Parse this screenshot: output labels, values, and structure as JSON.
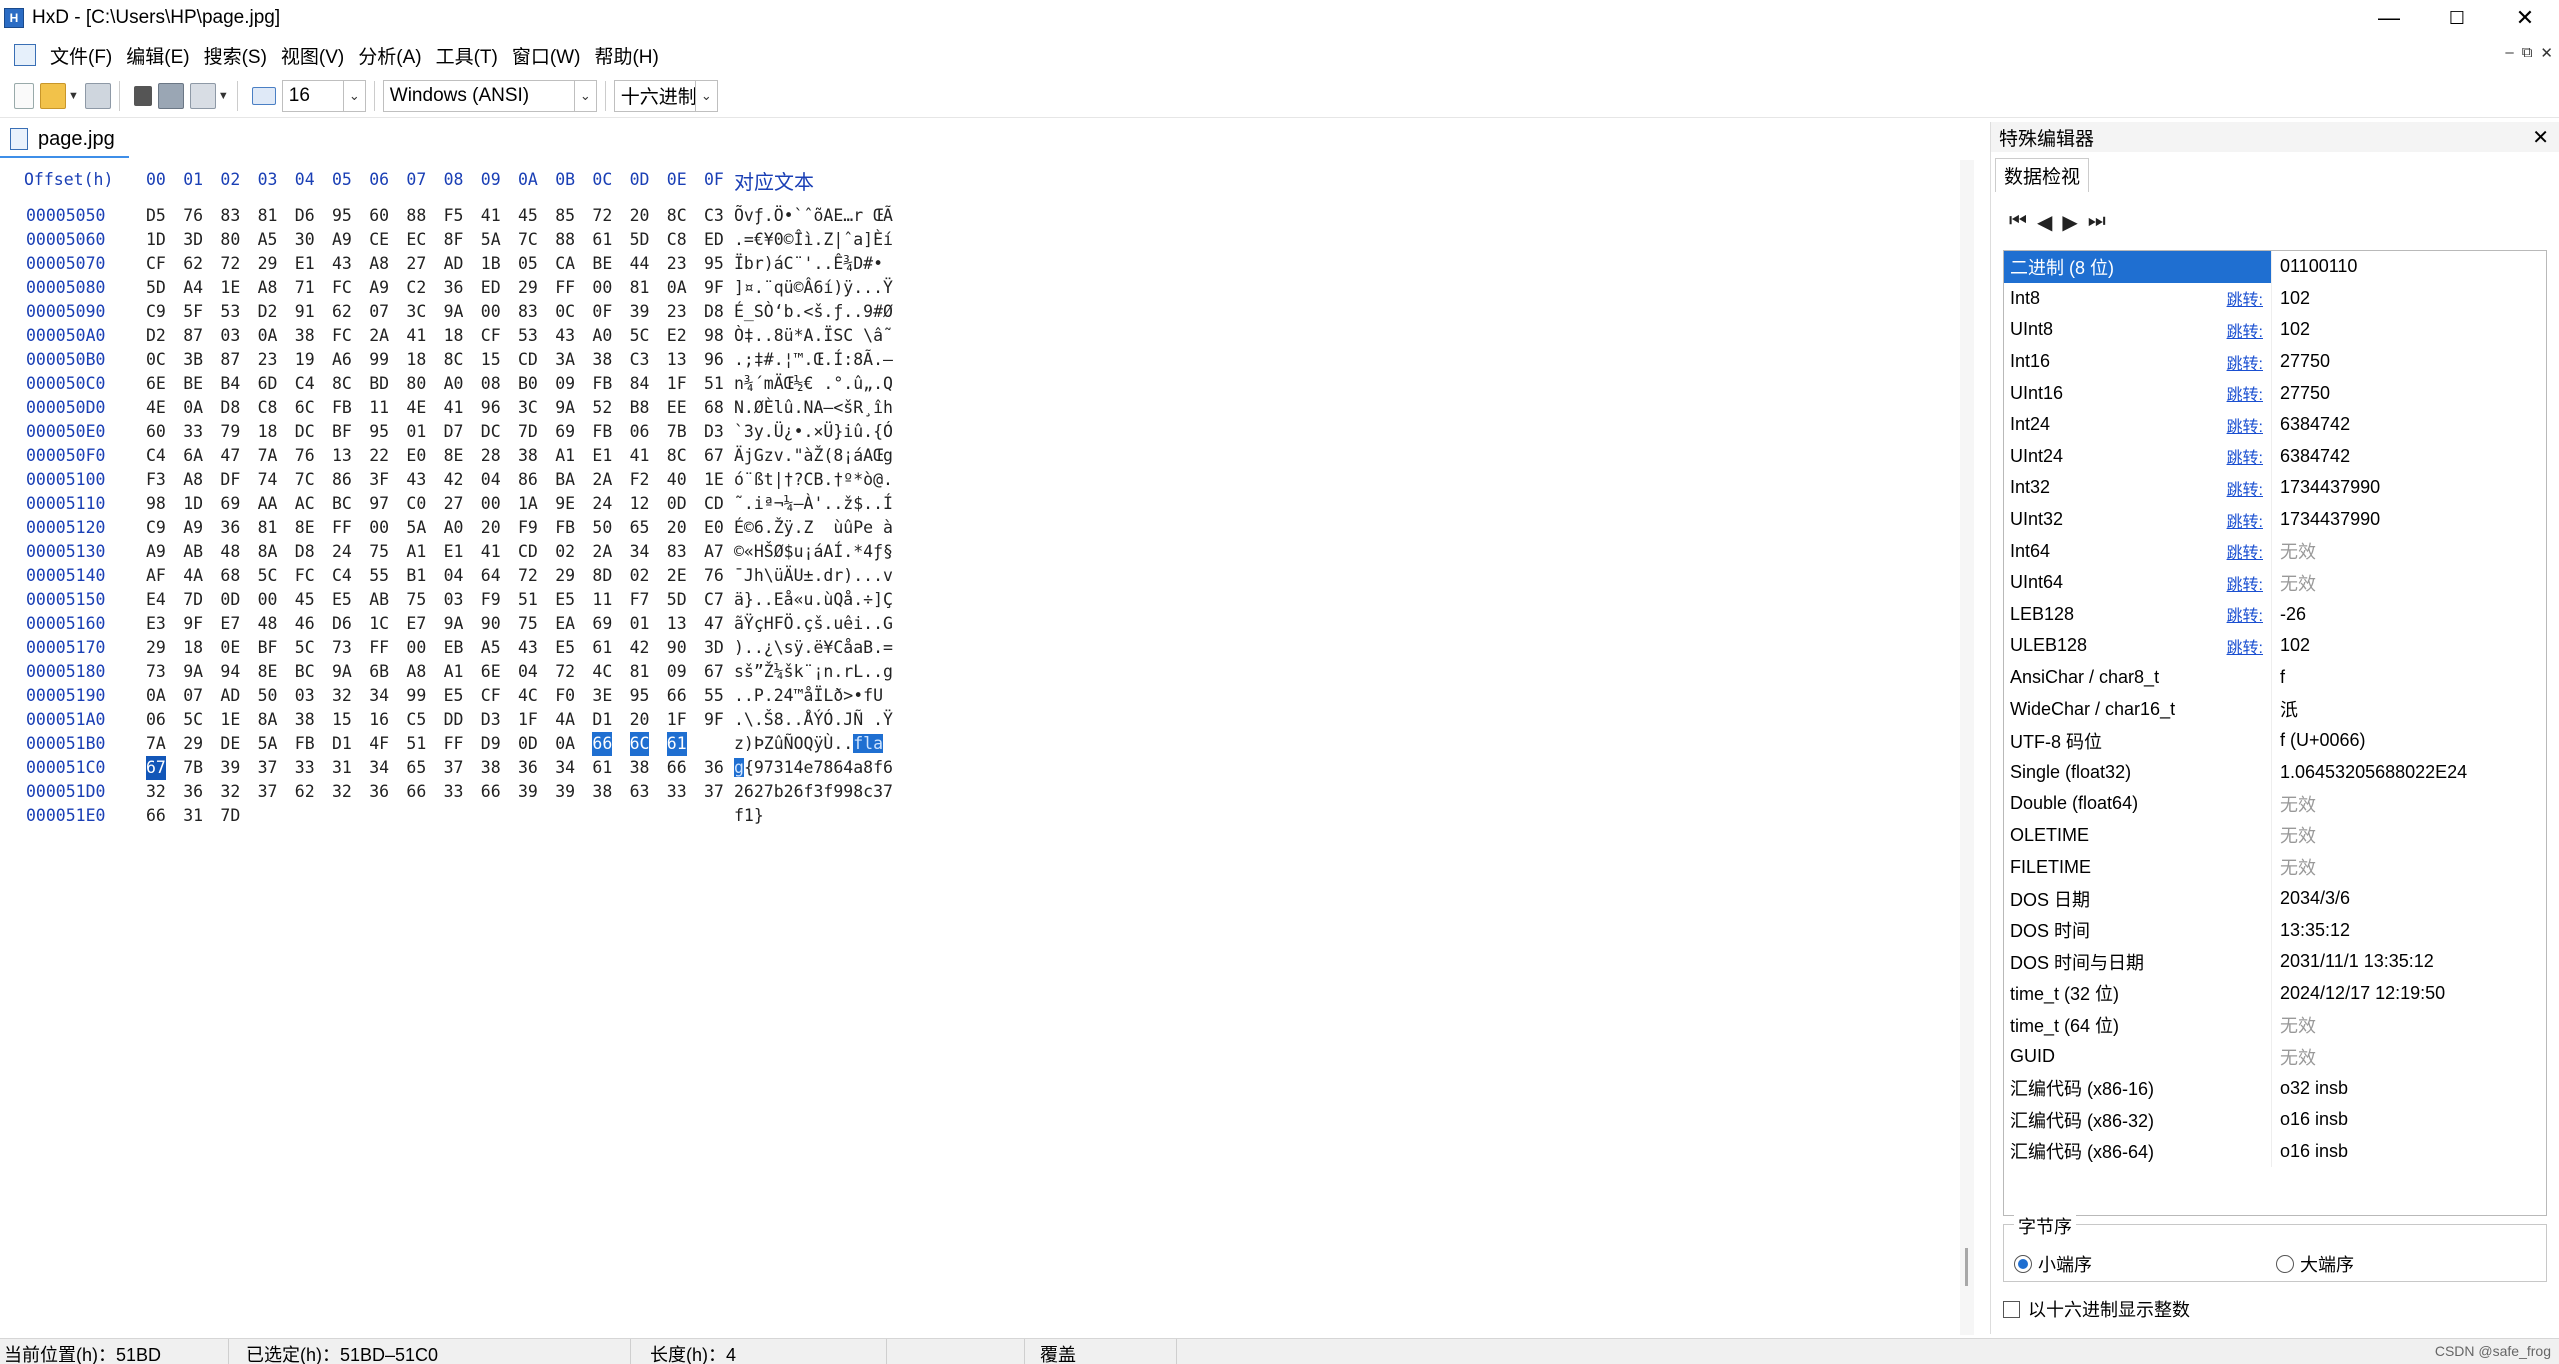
{
  "window": {
    "title": "HxD - [C:\\Users\\HP\\page.jpg]",
    "minimize": "—",
    "maximize": "☐",
    "close": "✕"
  },
  "menu": {
    "items": [
      "文件(F)",
      "编辑(E)",
      "搜索(S)",
      "视图(V)",
      "分析(A)",
      "工具(T)",
      "窗口(W)",
      "帮助(H)"
    ],
    "mdi": [
      "–",
      "⧉",
      "✕"
    ]
  },
  "toolbar": {
    "bytes_per_row": "16",
    "encoding": "Windows (ANSI)",
    "offset_base": "十六进制"
  },
  "document_tab": {
    "label": "page.jpg"
  },
  "hex": {
    "header_offset": "Offset(h)",
    "header_columns": [
      "00",
      "01",
      "02",
      "03",
      "04",
      "05",
      "06",
      "07",
      "08",
      "09",
      "0A",
      "0B",
      "0C",
      "0D",
      "0E",
      "0F"
    ],
    "header_text": "对应文本",
    "rows": [
      {
        "offset": "00005050",
        "bytes": [
          "D5",
          "76",
          "83",
          "81",
          "D6",
          "95",
          "60",
          "88",
          "F5",
          "41",
          "45",
          "85",
          "72",
          "20",
          "8C",
          "C3"
        ],
        "text": "Õvƒ.Ö•`ˆõAE…r ŒÃ"
      },
      {
        "offset": "00005060",
        "bytes": [
          "1D",
          "3D",
          "80",
          "A5",
          "30",
          "A9",
          "CE",
          "EC",
          "8F",
          "5A",
          "7C",
          "88",
          "61",
          "5D",
          "C8",
          "ED"
        ],
        "text": ".=€¥0©Îì.Z|ˆa]Èí"
      },
      {
        "offset": "00005070",
        "bytes": [
          "CF",
          "62",
          "72",
          "29",
          "E1",
          "43",
          "A8",
          "27",
          "AD",
          "1B",
          "05",
          "CA",
          "BE",
          "44",
          "23",
          "95"
        ],
        "text": "Ïbr)áC¨'­..Ê¾D#•"
      },
      {
        "offset": "00005080",
        "bytes": [
          "5D",
          "A4",
          "1E",
          "A8",
          "71",
          "FC",
          "A9",
          "C2",
          "36",
          "ED",
          "29",
          "FF",
          "00",
          "81",
          "0A",
          "9F"
        ],
        "text": "]¤.¨qü©Â6í)ÿ...Ÿ"
      },
      {
        "offset": "00005090",
        "bytes": [
          "C9",
          "5F",
          "53",
          "D2",
          "91",
          "62",
          "07",
          "3C",
          "9A",
          "00",
          "83",
          "0C",
          "0F",
          "39",
          "23",
          "D8"
        ],
        "text": "É_SÒ‘b.<š.ƒ..9#Ø"
      },
      {
        "offset": "000050A0",
        "bytes": [
          "D2",
          "87",
          "03",
          "0A",
          "38",
          "FC",
          "2A",
          "41",
          "18",
          "CF",
          "53",
          "43",
          "A0",
          "5C",
          "E2",
          "98"
        ],
        "text": "Ò‡..8ü*A.ÏSC \\â˜"
      },
      {
        "offset": "000050B0",
        "bytes": [
          "0C",
          "3B",
          "87",
          "23",
          "19",
          "A6",
          "99",
          "18",
          "8C",
          "15",
          "CD",
          "3A",
          "38",
          "C3",
          "13",
          "96"
        ],
        "text": ".;‡#.¦™.Œ.Í:8Ã.–"
      },
      {
        "offset": "000050C0",
        "bytes": [
          "6E",
          "BE",
          "B4",
          "6D",
          "C4",
          "8C",
          "BD",
          "80",
          "A0",
          "08",
          "B0",
          "09",
          "FB",
          "84",
          "1F",
          "51"
        ],
        "text": "n¾´mÄŒ½€ .°.û„.Q"
      },
      {
        "offset": "000050D0",
        "bytes": [
          "4E",
          "0A",
          "D8",
          "C8",
          "6C",
          "FB",
          "11",
          "4E",
          "41",
          "96",
          "3C",
          "9A",
          "52",
          "B8",
          "EE",
          "68"
        ],
        "text": "N.ØÈlû.NA–<šR¸îh"
      },
      {
        "offset": "000050E0",
        "bytes": [
          "60",
          "33",
          "79",
          "18",
          "DC",
          "BF",
          "95",
          "01",
          "D7",
          "DC",
          "7D",
          "69",
          "FB",
          "06",
          "7B",
          "D3"
        ],
        "text": "`3y.Ü¿•.×Ü}iû.{Ó"
      },
      {
        "offset": "000050F0",
        "bytes": [
          "C4",
          "6A",
          "47",
          "7A",
          "76",
          "13",
          "22",
          "E0",
          "8E",
          "28",
          "38",
          "A1",
          "E1",
          "41",
          "8C",
          "67"
        ],
        "text": "ÄjGzv.\"àŽ(8¡áAŒg"
      },
      {
        "offset": "00005100",
        "bytes": [
          "F3",
          "A8",
          "DF",
          "74",
          "7C",
          "86",
          "3F",
          "43",
          "42",
          "04",
          "86",
          "BA",
          "2A",
          "F2",
          "40",
          "1E"
        ],
        "text": "ó¨ßt|†?CB.†º*ò@."
      },
      {
        "offset": "00005110",
        "bytes": [
          "98",
          "1D",
          "69",
          "AA",
          "AC",
          "BC",
          "97",
          "C0",
          "27",
          "00",
          "1A",
          "9E",
          "24",
          "12",
          "0D",
          "CD"
        ],
        "text": "˜.iª¬¼—À'..ž$..Í"
      },
      {
        "offset": "00005120",
        "bytes": [
          "C9",
          "A9",
          "36",
          "81",
          "8E",
          "FF",
          "00",
          "5A",
          "A0",
          "20",
          "F9",
          "FB",
          "50",
          "65",
          "20",
          "E0"
        ],
        "text": "É©6.Žÿ.Z  ùûPe à"
      },
      {
        "offset": "00005130",
        "bytes": [
          "A9",
          "AB",
          "48",
          "8A",
          "D8",
          "24",
          "75",
          "A1",
          "E1",
          "41",
          "CD",
          "02",
          "2A",
          "34",
          "83",
          "A7"
        ],
        "text": "©«HŠØ$u¡áAÍ.*4ƒ§"
      },
      {
        "offset": "00005140",
        "bytes": [
          "AF",
          "4A",
          "68",
          "5C",
          "FC",
          "C4",
          "55",
          "B1",
          "04",
          "64",
          "72",
          "29",
          "8D",
          "02",
          "2E",
          "76"
        ],
        "text": "¯Jh\\üÄU±.dr)...v"
      },
      {
        "offset": "00005150",
        "bytes": [
          "E4",
          "7D",
          "0D",
          "00",
          "45",
          "E5",
          "AB",
          "75",
          "03",
          "F9",
          "51",
          "E5",
          "11",
          "F7",
          "5D",
          "C7"
        ],
        "text": "ä}..Eå«u.ùQå.÷]Ç"
      },
      {
        "offset": "00005160",
        "bytes": [
          "E3",
          "9F",
          "E7",
          "48",
          "46",
          "D6",
          "1C",
          "E7",
          "9A",
          "90",
          "75",
          "EA",
          "69",
          "01",
          "13",
          "47"
        ],
        "text": "ãŸçHFÖ.çš.uêi..G"
      },
      {
        "offset": "00005170",
        "bytes": [
          "29",
          "18",
          "0E",
          "BF",
          "5C",
          "73",
          "FF",
          "00",
          "EB",
          "A5",
          "43",
          "E5",
          "61",
          "42",
          "90",
          "3D"
        ],
        "text": ")..¿\\sÿ.ë¥CåaB.="
      },
      {
        "offset": "00005180",
        "bytes": [
          "73",
          "9A",
          "94",
          "8E",
          "BC",
          "9A",
          "6B",
          "A8",
          "A1",
          "6E",
          "04",
          "72",
          "4C",
          "81",
          "09",
          "67"
        ],
        "text": "sš”Ž¼šk¨¡n.rL..g"
      },
      {
        "offset": "00005190",
        "bytes": [
          "0A",
          "07",
          "AD",
          "50",
          "03",
          "32",
          "34",
          "99",
          "E5",
          "CF",
          "4C",
          "F0",
          "3E",
          "95",
          "66",
          "55"
        ],
        "text": "..­P.24™åÏLð>•fU"
      },
      {
        "offset": "000051A0",
        "bytes": [
          "06",
          "5C",
          "1E",
          "8A",
          "38",
          "15",
          "16",
          "C5",
          "DD",
          "D3",
          "1F",
          "4A",
          "D1",
          "20",
          "1F",
          "9F"
        ],
        "text": ".\\.Š8..ÅÝÓ.JÑ .Ÿ"
      },
      {
        "offset": "000051B0",
        "bytes": [
          "7A",
          "29",
          "DE",
          "5A",
          "FB",
          "D1",
          "4F",
          "51",
          "FF",
          "D9",
          "0D",
          "0A",
          "66",
          "6C",
          "61"
        ],
        "text": "z)ÞZûÑOQÿÙ..",
        "text_sel": "fla"
      },
      {
        "offset": "000051C0",
        "bytes": [
          "67",
          "7B",
          "39",
          "37",
          "33",
          "31",
          "34",
          "65",
          "37",
          "38",
          "36",
          "34",
          "61",
          "38",
          "66",
          "36"
        ],
        "text_sel": "g",
        "text": "{97314e7864a8f6"
      },
      {
        "offset": "000051D0",
        "bytes": [
          "32",
          "36",
          "32",
          "37",
          "62",
          "32",
          "36",
          "66",
          "33",
          "66",
          "39",
          "39",
          "38",
          "63",
          "33",
          "37"
        ],
        "text": "2627b26f3f998c37"
      },
      {
        "offset": "000051E0",
        "bytes": [
          "66",
          "31",
          "7D"
        ],
        "text": "f1}"
      }
    ]
  },
  "panel": {
    "title": "特殊编辑器",
    "close": "✕",
    "tab": "数据检视",
    "nav": [
      "⏮",
      "◀",
      "▶",
      "⏭"
    ],
    "jump_label": "跳转:",
    "rows": [
      {
        "name": "二进制 (8 位)",
        "value": "01100110",
        "jump": false,
        "selected": true
      },
      {
        "name": "Int8",
        "value": "102",
        "jump": true
      },
      {
        "name": "UInt8",
        "value": "102",
        "jump": true
      },
      {
        "name": "Int16",
        "value": "27750",
        "jump": true
      },
      {
        "name": "UInt16",
        "value": "27750",
        "jump": true
      },
      {
        "name": "Int24",
        "value": "6384742",
        "jump": true
      },
      {
        "name": "UInt24",
        "value": "6384742",
        "jump": true
      },
      {
        "name": "Int32",
        "value": "1734437990",
        "jump": true
      },
      {
        "name": "UInt32",
        "value": "1734437990",
        "jump": true
      },
      {
        "name": "Int64",
        "value": "无效",
        "jump": true,
        "invalid": true
      },
      {
        "name": "UInt64",
        "value": "无效",
        "jump": true,
        "invalid": true
      },
      {
        "name": "LEB128",
        "value": "-26",
        "jump": true
      },
      {
        "name": "ULEB128",
        "value": "102",
        "jump": true
      },
      {
        "name": "AnsiChar / char8_t",
        "value": "f",
        "jump": false
      },
      {
        "name": "WideChar / char16_t",
        "value": "汦",
        "jump": false
      },
      {
        "name": "UTF-8 码位",
        "value": "f (U+0066)",
        "jump": false
      },
      {
        "name": "Single (float32)",
        "value": "1.06453205688022E24",
        "jump": false
      },
      {
        "name": "Double (float64)",
        "value": "无效",
        "jump": false,
        "invalid": true
      },
      {
        "name": "OLETIME",
        "value": "无效",
        "jump": false,
        "invalid": true
      },
      {
        "name": "FILETIME",
        "value": "无效",
        "jump": false,
        "invalid": true
      },
      {
        "name": "DOS 日期",
        "value": "2034/3/6",
        "jump": false
      },
      {
        "name": "DOS 时间",
        "value": "13:35:12",
        "jump": false
      },
      {
        "name": "DOS 时间与日期",
        "value": "2031/11/1 13:35:12",
        "jump": false
      },
      {
        "name": "time_t (32 位)",
        "value": "2024/12/17 12:19:50",
        "jump": false
      },
      {
        "name": "time_t (64 位)",
        "value": "无效",
        "jump": false,
        "invalid": true
      },
      {
        "name": "GUID",
        "value": "无效",
        "jump": false,
        "invalid": true
      },
      {
        "name": "汇编代码 (x86-16)",
        "value": "o32 insb",
        "jump": false
      },
      {
        "name": "汇编代码 (x86-32)",
        "value": "o16 insb",
        "jump": false
      },
      {
        "name": "汇编代码 (x86-64)",
        "value": "o16 insb",
        "jump": false
      }
    ],
    "byte_order": {
      "legend": "字节序",
      "little": "小端序",
      "big": "大端序"
    },
    "hex_int_label": "以十六进制显示整数"
  },
  "status": {
    "position": "当前位置(h)：51BD",
    "selection": "已选定(h)：51BD–51C0",
    "length": "长度(h)：4",
    "mode": "覆盖",
    "watermark": "CSDN @safe_frog"
  }
}
